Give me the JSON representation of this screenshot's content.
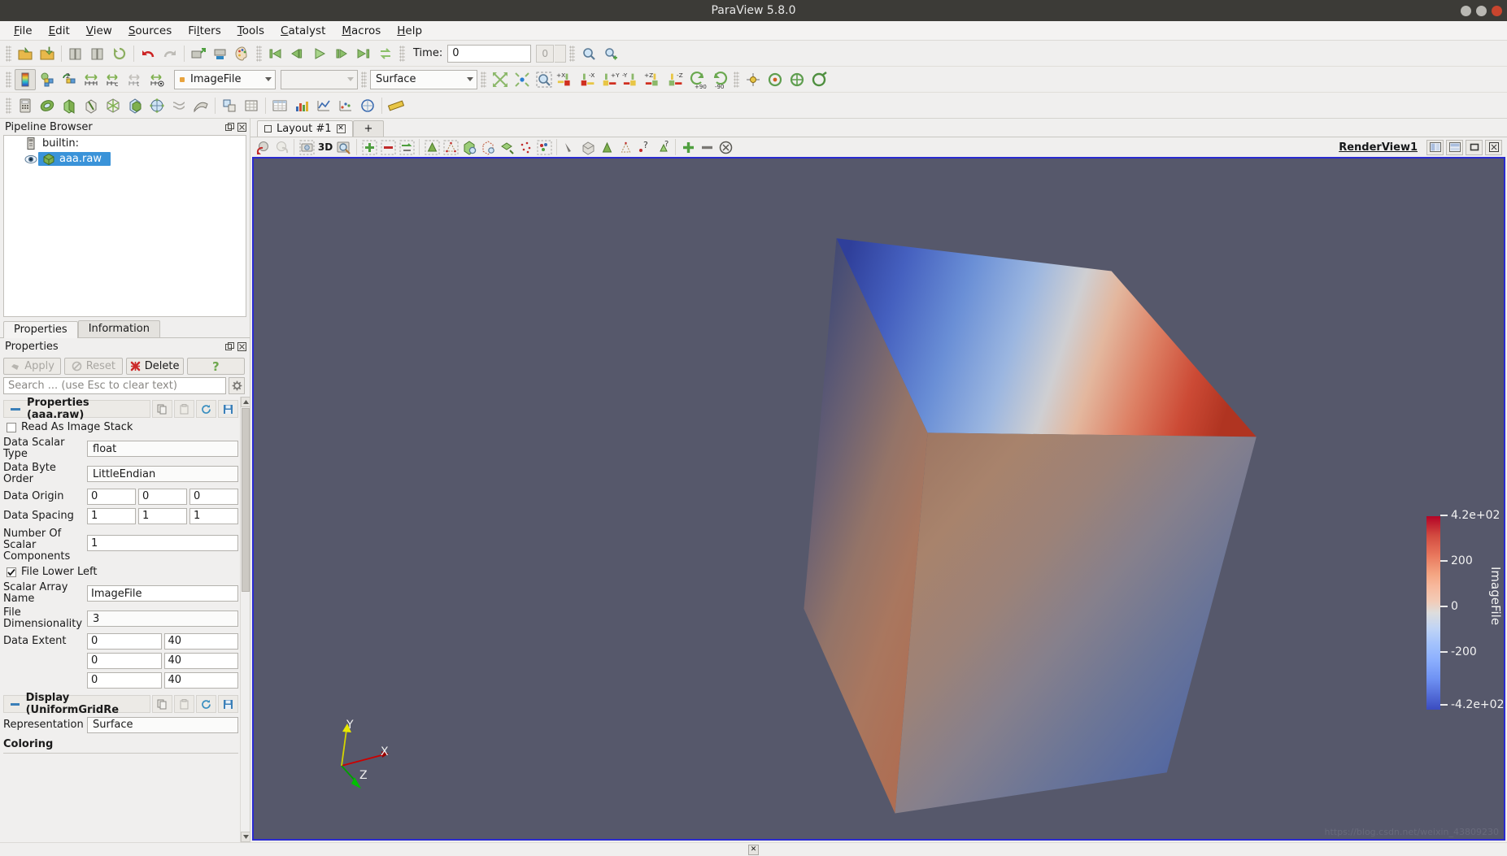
{
  "window": {
    "title": "ParaView 5.8.0"
  },
  "menubar": {
    "items": [
      {
        "label": "File",
        "mnemonic": "F"
      },
      {
        "label": "Edit",
        "mnemonic": "E"
      },
      {
        "label": "View",
        "mnemonic": "V"
      },
      {
        "label": "Sources",
        "mnemonic": "S"
      },
      {
        "label": "Filters",
        "mnemonic": "l"
      },
      {
        "label": "Tools",
        "mnemonic": "T"
      },
      {
        "label": "Catalyst",
        "mnemonic": "C"
      },
      {
        "label": "Macros",
        "mnemonic": "M"
      },
      {
        "label": "Help",
        "mnemonic": "H"
      }
    ]
  },
  "main_toolbar": {
    "icons": [
      "open-file-icon",
      "open-recent-icon",
      "save-data-icon",
      "save-state-icon",
      "load-state-icon",
      "undo-icon",
      "redo-icon",
      "connect-icon",
      "disconnect-icon",
      "color-palette-icon",
      "first-frame-icon",
      "previous-frame-icon",
      "play-icon",
      "next-frame-icon",
      "last-frame-icon",
      "loop-icon"
    ],
    "time_label": "Time:",
    "time_value": "0",
    "frame_value": "0",
    "zoom_icons": [
      "magnify-icon",
      "magnify-plus-icon"
    ]
  },
  "representation_toolbar": {
    "icons": [
      "color-map-editor-icon",
      "rescale-custom-icon",
      "rescale-reset-icon",
      "rescale-data-range-icon",
      "rescale-time-icon",
      "rescale-temporal-icon",
      "rescale-visible-icon"
    ],
    "array_value": "ImageFile",
    "component_value": "",
    "representation_value": "Surface",
    "camera_icons": [
      "reset-camera-icon",
      "zoom-to-data-icon",
      "zoom-to-box-icon",
      "plus-x-icon",
      "minus-x-icon",
      "plus-y-icon",
      "minus-y-icon",
      "plus-z-icon",
      "minus-z-icon",
      "rotate-90-icon",
      "rotate-minus-90-icon"
    ],
    "right_icons": [
      "center-axes-icon",
      "reset-center-icon",
      "pick-center-icon",
      "show-center-icon"
    ]
  },
  "sources_toolbar": {
    "icons": [
      "calculator-icon",
      "contour-icon",
      "clip-icon",
      "slice-icon",
      "threshold-icon",
      "extract-subset-icon",
      "glyph-icon",
      "stream-tracer-icon",
      "warp-icon",
      "group-datasets-icon",
      "extract-level-icon",
      "spreadsheet-icon",
      "histogram-icon",
      "plot-over-line-icon",
      "plot-data-icon",
      "plot-selection-icon",
      "ruler-icon"
    ]
  },
  "pipeline_browser": {
    "title": "Pipeline Browser",
    "items": [
      {
        "label": "builtin:",
        "icon": "server-icon",
        "selected": false,
        "eye": false
      },
      {
        "label": "aaa.raw",
        "icon": "cube-green-icon",
        "selected": true,
        "eye": true
      }
    ]
  },
  "side_tabs": [
    {
      "label": "Properties",
      "active": true
    },
    {
      "label": "Information",
      "active": false
    }
  ],
  "properties_panel": {
    "title": "Properties",
    "buttons": [
      {
        "label": "Apply",
        "icon": "apply-icon",
        "enabled": false
      },
      {
        "label": "Reset",
        "icon": "reset-icon",
        "enabled": false
      },
      {
        "label": "Delete",
        "icon": "delete-x-icon",
        "enabled": true
      },
      {
        "label": "?",
        "icon": "help-icon",
        "enabled": true
      }
    ],
    "search_placeholder": "Search ... (use Esc to clear text)",
    "gear_icon": "gear-icon",
    "groups": [
      {
        "title": "Properties (aaa.raw)",
        "icon_buttons": [
          "copy-icon",
          "paste-icon",
          "restore-defaults-icon",
          "save-as-defaults-icon"
        ],
        "fields": {
          "read_as_image_stack": {
            "label": "Read As Image Stack",
            "checked": false
          },
          "data_scalar_type": {
            "label": "Data Scalar Type",
            "value": "float"
          },
          "data_byte_order": {
            "label": "Data Byte Order",
            "value": "LittleEndian"
          },
          "data_origin": {
            "label": "Data Origin",
            "values": [
              "0",
              "0",
              "0"
            ]
          },
          "data_spacing": {
            "label": "Data Spacing",
            "values": [
              "1",
              "1",
              "1"
            ]
          },
          "num_scalar_components": {
            "label": "Number Of Scalar Components",
            "value": "1"
          },
          "file_lower_left": {
            "label": "File Lower Left",
            "checked": true
          },
          "scalar_array_name": {
            "label": "Scalar Array Name",
            "value": "ImageFile"
          },
          "file_dimensionality": {
            "label": "File Dimensionality",
            "value": "3"
          },
          "data_extent": {
            "label": "Data Extent",
            "rows": [
              [
                "0",
                "40"
              ],
              [
                "0",
                "40"
              ],
              [
                "0",
                "40"
              ]
            ]
          }
        }
      },
      {
        "title": "Display (UniformGridRe",
        "icon_buttons": [
          "copy-icon",
          "paste-icon",
          "restore-defaults-icon",
          "save-as-defaults-icon"
        ],
        "fields": {
          "representation": {
            "label": "Representation",
            "value": "Surface"
          }
        },
        "section_header": "Coloring"
      }
    ]
  },
  "layout": {
    "tabs": [
      {
        "label": "Layout #1",
        "icon": "layout-icon",
        "closable": true,
        "active": true
      },
      {
        "label": "+",
        "active": false
      }
    ]
  },
  "view_toolbar": {
    "icons": [
      "undo-camera-icon",
      "redo-camera-icon",
      "screenshot-icon",
      "3d-icon",
      "select-icon",
      "add-selection-icon",
      "subtract-selection-icon",
      "toggle-selection-icon",
      "select-cells-icon",
      "select-points-icon",
      "select-cells-through-icon",
      "select-points-through-icon",
      "select-block-icon",
      "interactive-select-cells-icon",
      "interactive-select-points-icon",
      "hover-cells-icon",
      "hover-points-icon",
      "select-cells-polygon-icon",
      "select-points-polygon-icon",
      "query-cells-icon",
      "query-points-icon",
      "grow-selection-icon",
      "shrink-selection-icon",
      "clear-selection-icon"
    ],
    "label_3d": "3D",
    "view_name": "RenderView1",
    "view_buttons": [
      "split-horizontal-icon",
      "split-vertical-icon",
      "maximize-icon",
      "close-view-icon"
    ]
  },
  "render_view": {
    "background_color": "#56586b",
    "border_color": "#2a2ad0",
    "watermark": "https://blog.csdn.net/weixin_43809230",
    "orientation_axes": {
      "x": {
        "label": "X",
        "color": "#d00000"
      },
      "y": {
        "label": "Y",
        "color": "#e0e000"
      },
      "z": {
        "label": "Z",
        "color": "#00b000"
      }
    },
    "color_legend": {
      "title": "ImageFile",
      "ticks": [
        "4.2e+02",
        "200",
        "0",
        "-200",
        "-4.2e+02"
      ],
      "colormap": "Cool to Warm",
      "top_color": "#b40426",
      "mid_color": "#dddddd",
      "bottom_color": "#3b4cc0"
    }
  },
  "status_bar": {
    "close_icon": "close-small-icon"
  }
}
